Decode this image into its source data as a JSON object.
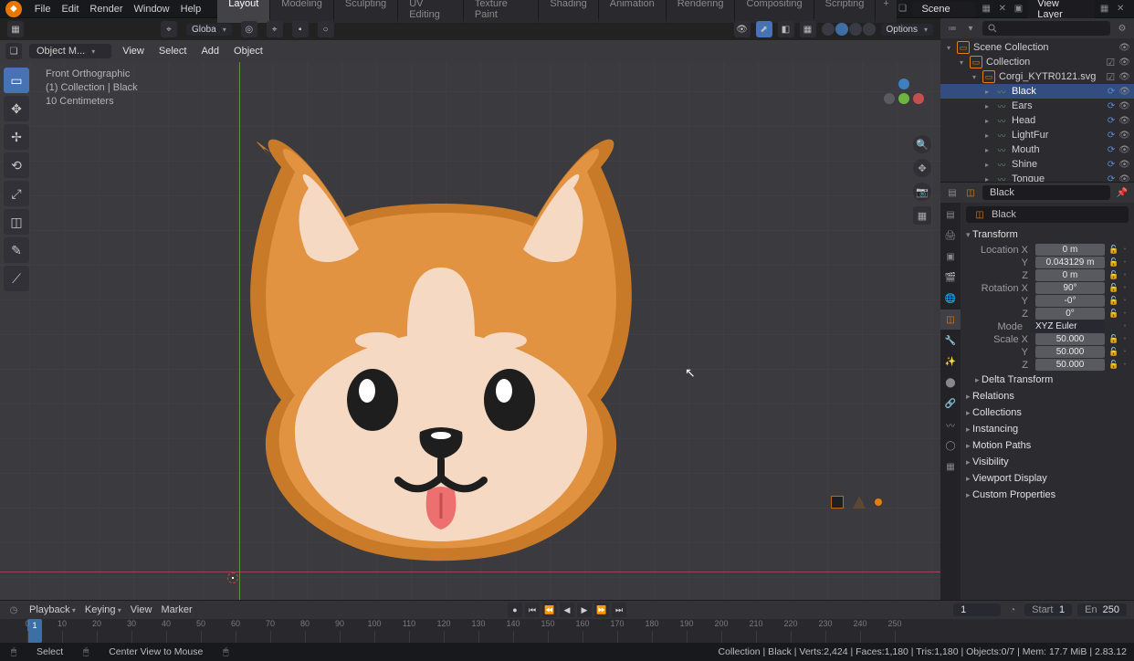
{
  "menu": [
    "File",
    "Edit",
    "Render",
    "Window",
    "Help"
  ],
  "workspaces": [
    "Layout",
    "Modeling",
    "Sculpting",
    "UV Editing",
    "Texture Paint",
    "Shading",
    "Animation",
    "Rendering",
    "Compositing",
    "Scripting"
  ],
  "activeWorkspace": "Layout",
  "scene": {
    "scene": "Scene",
    "viewLayer": "View Layer"
  },
  "header": {
    "orientation": "Globa",
    "options": "Options"
  },
  "editor": {
    "mode": "Object M...",
    "menus": [
      "View",
      "Select",
      "Add",
      "Object"
    ]
  },
  "overlay": {
    "view": "Front Orthographic",
    "coll": "(1) Collection | Black",
    "scale": "10 Centimeters"
  },
  "outliner": {
    "root": "Scene Collection",
    "collection": "Collection",
    "svg": "Corgi_KYTR0121.svg",
    "items": [
      "Black",
      "Ears",
      "Head",
      "LightFur",
      "Mouth",
      "Shine",
      "Tongue"
    ],
    "selected": "Black"
  },
  "props": {
    "breadcrumb": "Black",
    "name": "Black",
    "transform": {
      "location": {
        "X": "0 m",
        "Y": "0.043129 m",
        "Z": "0 m"
      },
      "rotation": {
        "X": "90°",
        "Y": "-0°",
        "Z": "0°"
      },
      "mode": "XYZ Euler",
      "scale": {
        "X": "50.000",
        "Y": "50.000",
        "Z": "50.000"
      }
    },
    "sections": [
      "Delta Transform",
      "Relations",
      "Collections",
      "Instancing",
      "Motion Paths",
      "Visibility",
      "Viewport Display",
      "Custom Properties"
    ]
  },
  "timeline": {
    "menus": [
      "Playback",
      "Keying",
      "View",
      "Marker"
    ],
    "current": "1",
    "start": {
      "l": "Start",
      "v": "1"
    },
    "end": {
      "l": "En",
      "v": "250"
    },
    "ticks": [
      "0",
      "10",
      "20",
      "30",
      "40",
      "50",
      "60",
      "70",
      "80",
      "90",
      "100",
      "110",
      "120",
      "130",
      "140",
      "150",
      "160",
      "170",
      "180",
      "190",
      "200",
      "210",
      "220",
      "230",
      "240",
      "250"
    ]
  },
  "status": {
    "left1": "Select",
    "left2": "Center View to Mouse",
    "right": "Collection | Black | Verts:2,424 | Faces:1,180 | Tris:1,180 | Objects:0/7 | Mem: 17.7 MiB | 2.83.12"
  }
}
